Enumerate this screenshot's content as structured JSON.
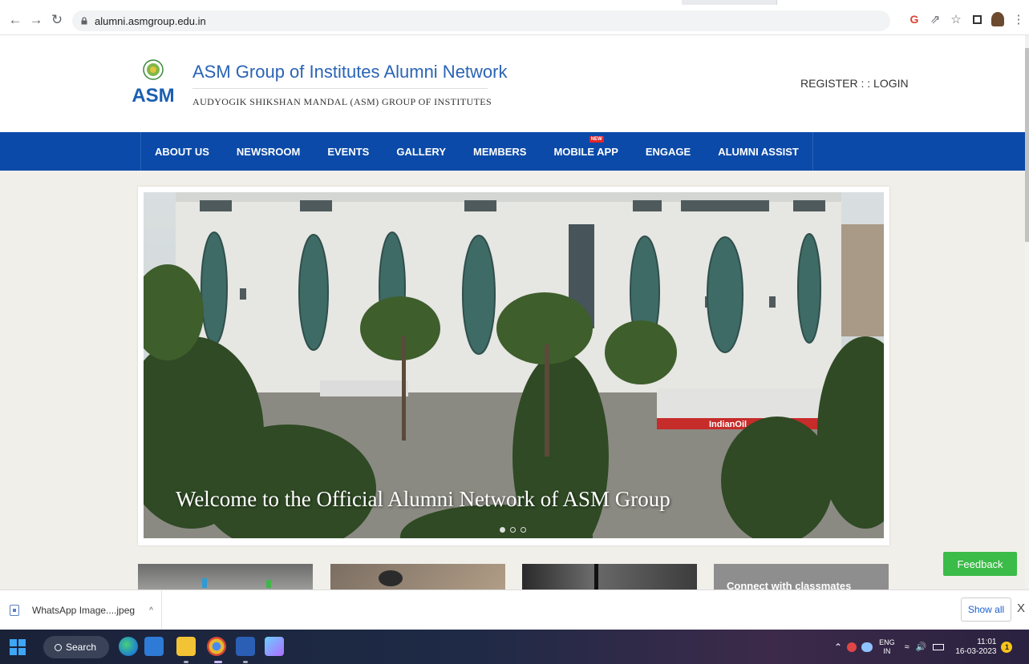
{
  "browser": {
    "url": "alumni.asmgroup.edu.in"
  },
  "site": {
    "title": "ASM Group of Institutes Alumni Network",
    "subtitle": "AUDYOGIK SHIKSHAN MANDAL (ASM) GROUP OF INSTITUTES",
    "logo_text": "ASM",
    "register_label": "REGISTER",
    "separator": " : : ",
    "login_label": "LOGIN",
    "nav": [
      {
        "label": "ABOUT US"
      },
      {
        "label": "NEWSROOM"
      },
      {
        "label": "EVENTS"
      },
      {
        "label": "GALLERY"
      },
      {
        "label": "MEMBERS"
      },
      {
        "label": "MOBILE APP",
        "badge": "NEW"
      },
      {
        "label": "ENGAGE"
      },
      {
        "label": "ALUMNI ASSIST"
      }
    ],
    "hero_caption": "Welcome to the Official Alumni Network of ASM Group",
    "hero_sign": "IndianOil",
    "card_text": "Connect with classmates",
    "feedback_label": "Feedback"
  },
  "downloads": {
    "file_name": "WhatsApp Image....jpeg",
    "show_all_label": "Show all",
    "close_label": "X"
  },
  "taskbar": {
    "search_label": "Search",
    "lang_top": "ENG",
    "lang_bottom": "IN",
    "time": "11:01",
    "date": "16-03-2023",
    "notifications": "1"
  },
  "colors": {
    "nav_blue": "#0b4aa8",
    "title_blue": "#2a64b5",
    "feedback_green": "#3bbb47"
  }
}
